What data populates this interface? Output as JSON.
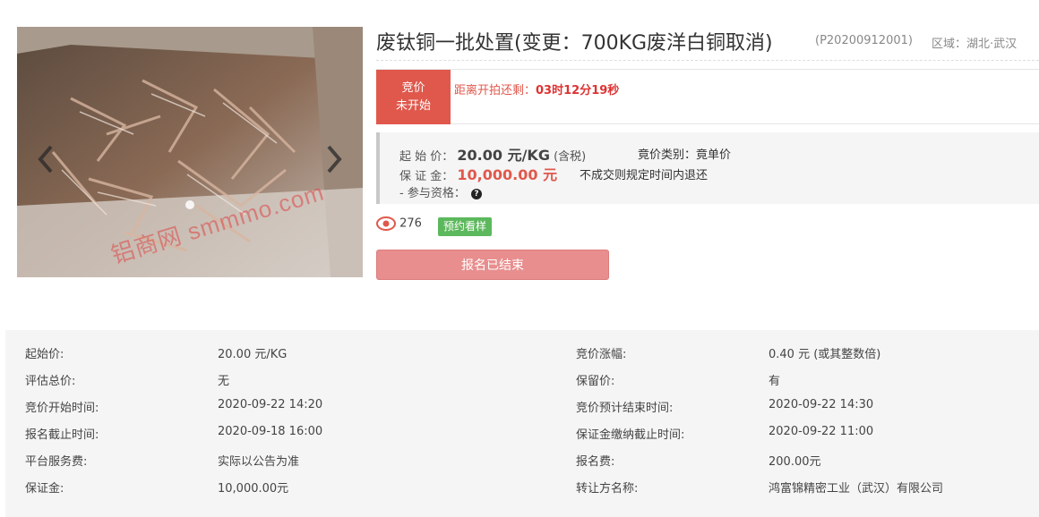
{
  "gallery": {
    "watermark": "铝商网 smmmo.com",
    "prev_icon": "chevron-left-icon",
    "next_icon": "chevron-right-icon"
  },
  "header": {
    "title": "废钛铜一批处置(变更：700KG废洋白铜取消)",
    "lot_code": "(P20200912001)",
    "region": "区域：湖北·武汉"
  },
  "countdown": {
    "status_line1": "竞价",
    "status_line2": "未开始",
    "label": "距离开拍还剩：",
    "value": "03时12分19秒"
  },
  "price": {
    "start_label": "起 始 价：",
    "start_value": "20.00 元/KG",
    "start_note": "(含税)",
    "type_label": "竟价类别：竟单价",
    "deposit_label": "保 证 金：",
    "deposit_value": "10,000.00 元",
    "deposit_note": "不成交则规定时间内退还",
    "qualify_label": "- 参与资格："
  },
  "stats": {
    "views": "276",
    "sample_tag": "预约看样"
  },
  "action": {
    "closed_label": "报名已结束"
  },
  "info_rows": [
    {
      "k1": "起始价:",
      "v1": "20.00 元/KG",
      "k2": "竞价涨幅:",
      "v2": "0.40 元 (或其整数倍)"
    },
    {
      "k1": "评估总价:",
      "v1": "无",
      "k2": "保留价:",
      "v2": "有"
    },
    {
      "k1": "竞价开始时间:",
      "v1": "2020-09-22 14:20",
      "k2": "竞价预计结束时间:",
      "v2": "2020-09-22 14:30"
    },
    {
      "k1": "报名截止时间:",
      "v1": "2020-09-18 16:00",
      "k2": "保证金缴纳截止时间:",
      "v2": "2020-09-22 11:00"
    },
    {
      "k1": "平台服务费:",
      "v1": "实际以公告为准",
      "k2": "报名费:",
      "v2": "200.00元"
    },
    {
      "k1": "保证金:",
      "v1": "10,000.00元",
      "k2": "转让方名称:",
      "v2": "鸿富锦精密工业（武汉）有限公司"
    }
  ],
  "colors": {
    "accent_red": "#e0584c",
    "button_closed": "#e88e8e",
    "tag_green": "#5cb85c"
  }
}
